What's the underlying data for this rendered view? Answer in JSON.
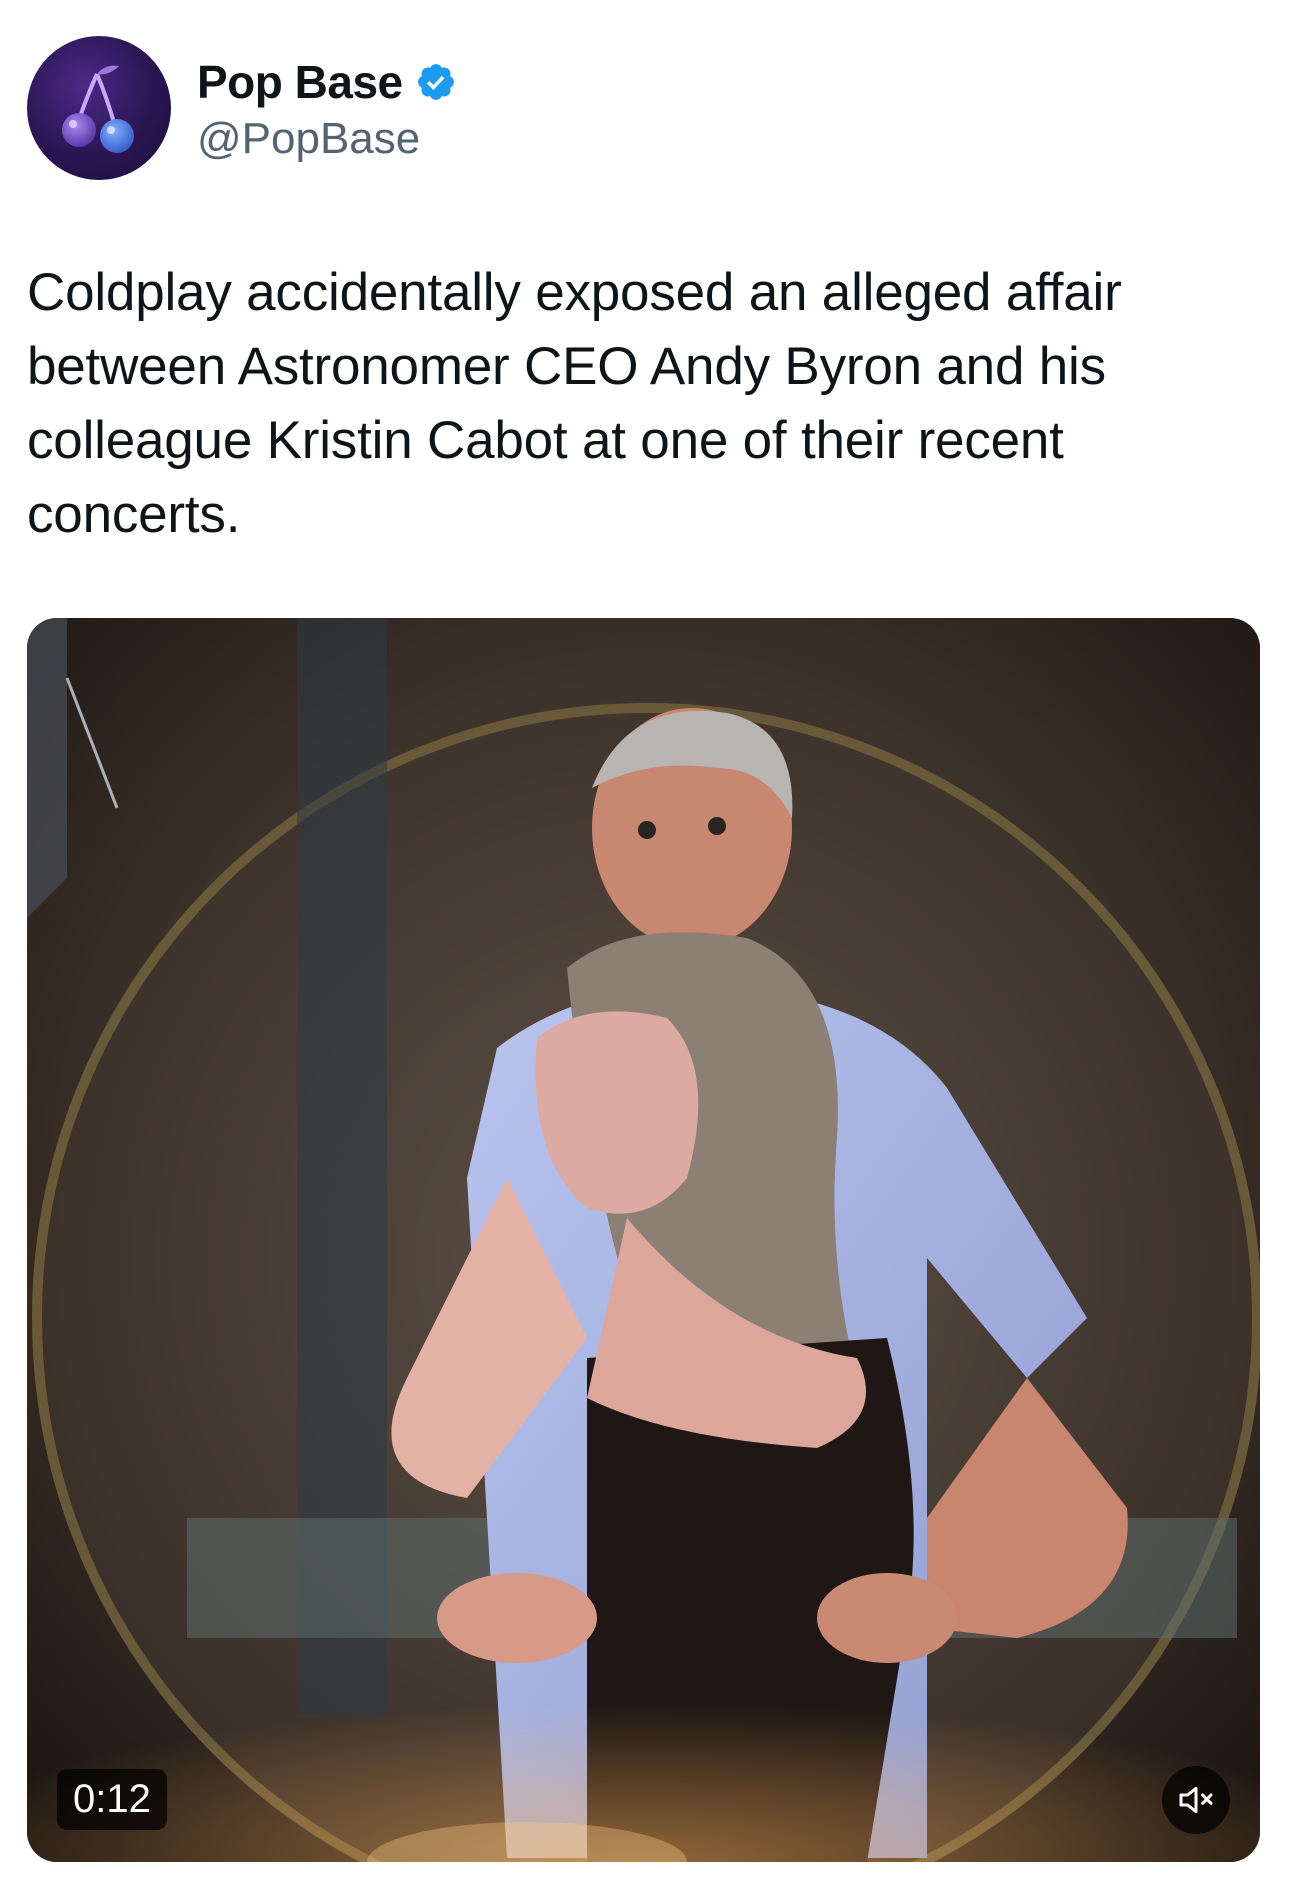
{
  "tweet": {
    "author": {
      "display_name": "Pop Base",
      "handle": "@PopBase",
      "verified": true,
      "avatar_icon": "cherries-icon"
    },
    "text": "Coldplay accidentally exposed an alleged affair between Astronomer CEO Andy Byron and his colleague Kristin Cabot at one of their recent concerts.",
    "media": {
      "type": "video",
      "duration": "0:12",
      "muted": true,
      "mute_icon": "speaker-muted-icon"
    }
  },
  "colors": {
    "text": "#0f1419",
    "secondary_text": "#536471",
    "verified_badge": "#1d9bf0"
  }
}
